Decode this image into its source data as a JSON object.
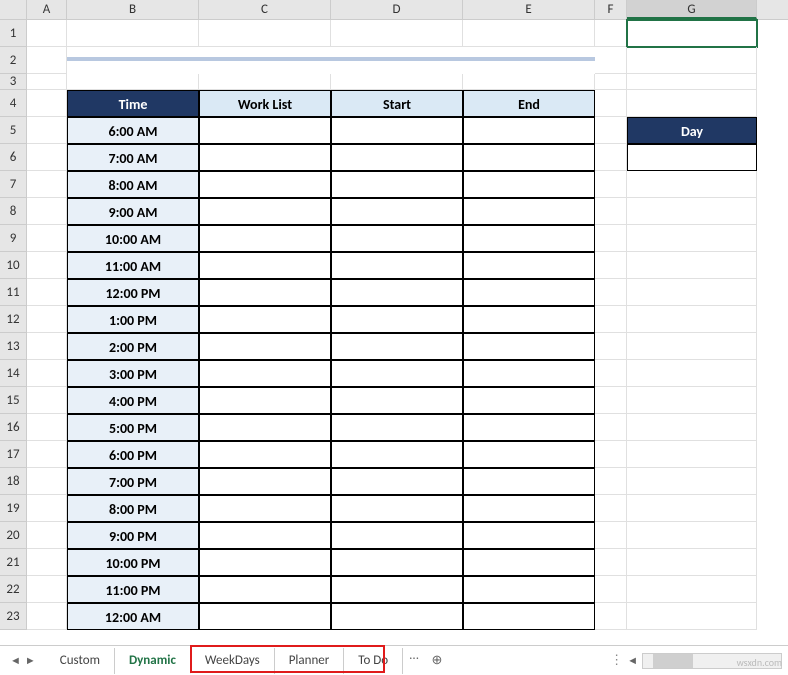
{
  "columns": [
    "A",
    "B",
    "C",
    "D",
    "E",
    "F",
    "G"
  ],
  "rows_count": 23,
  "table": {
    "headers": {
      "time": "Time",
      "worklist": "Work List",
      "start": "Start",
      "end": "End"
    },
    "times": [
      "6:00 AM",
      "7:00 AM",
      "8:00 AM",
      "9:00 AM",
      "10:00 AM",
      "11:00 AM",
      "12:00 PM",
      "1:00 PM",
      "2:00 PM",
      "3:00 PM",
      "4:00 PM",
      "5:00 PM",
      "6:00 PM",
      "7:00 PM",
      "8:00 PM",
      "9:00 PM",
      "10:00 PM",
      "11:00 PM",
      "12:00 AM"
    ]
  },
  "day_box": {
    "label": "Day",
    "value": ""
  },
  "tabs": {
    "items": [
      "Custom",
      "Dynamic",
      "WeekDays",
      "Planner",
      "To Do"
    ],
    "active": "Dynamic",
    "more": "...",
    "new_sheet": "+"
  },
  "nav": {
    "prev": "◄",
    "next": "►"
  },
  "watermark": "wsxdn.com",
  "selected_cell": "G1"
}
